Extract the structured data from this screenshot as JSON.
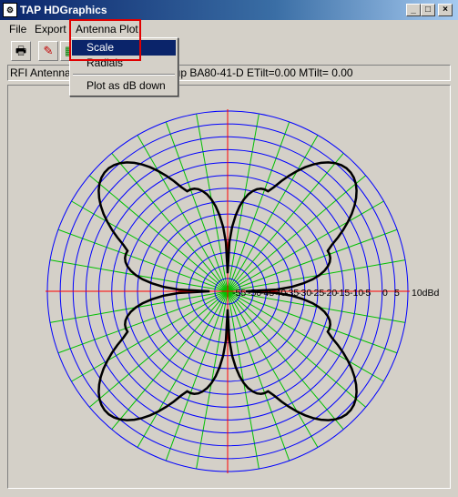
{
  "window": {
    "title": "TAP HDGraphics",
    "controls": {
      "minimize": "_",
      "maximize": "□",
      "close": "×"
    }
  },
  "menu": {
    "file": "File",
    "export": "Export",
    "antenna_plot": "Antenna Plot"
  },
  "dropdown": {
    "items": [
      "Scale",
      "Radials",
      "Plot as dB down"
    ],
    "selected": "Scale"
  },
  "toolbar": {
    "buttons": [
      "printer-icon",
      "edit-chart-icon",
      "green-chart-icon"
    ]
  },
  "info": {
    "left": "RFI Antennas",
    "right": "oup BA80-41-D ETilt=0.00 MTilt= 0.00"
  },
  "chart_data": {
    "type": "polar",
    "radial_scale_labels": [
      "-55",
      "-50",
      "-45",
      "-40",
      "-35",
      "-30",
      "-25",
      "-20",
      "-15",
      "-10",
      "-5",
      "0",
      "5",
      "10dBd"
    ],
    "colors": {
      "rings": "#0000ff",
      "radials": "#00c000",
      "axes": "#ff0000",
      "pattern": "#000000"
    }
  }
}
